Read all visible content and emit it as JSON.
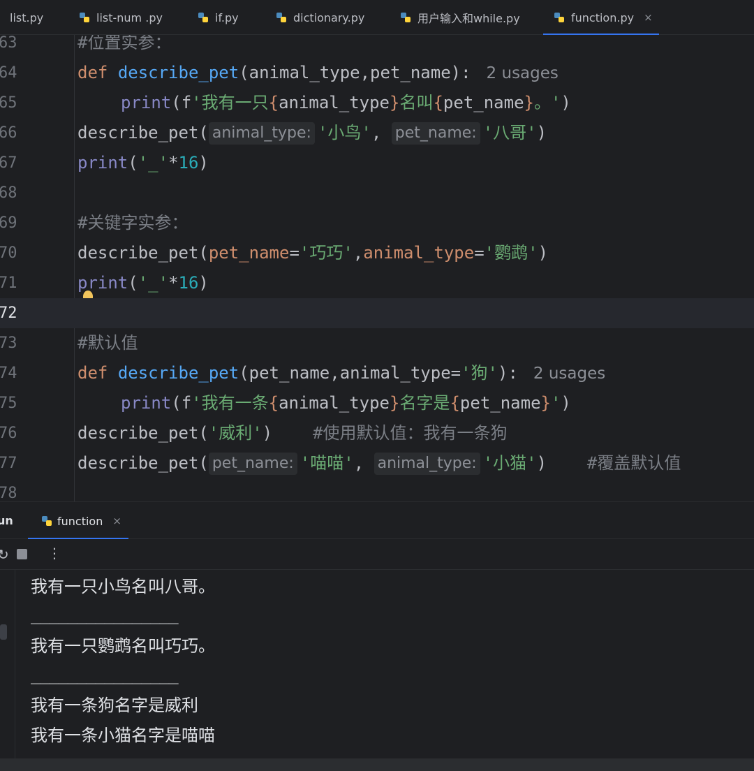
{
  "tabs": [
    {
      "label": "list.py",
      "active": false
    },
    {
      "label": "list-num .py",
      "active": false
    },
    {
      "label": "if.py",
      "active": false
    },
    {
      "label": "dictionary.py",
      "active": false
    },
    {
      "label": "用户输入和while.py",
      "active": false
    },
    {
      "label": "function.py",
      "active": true
    }
  ],
  "tab_close_glyph": "×",
  "editor": {
    "line_numbers": [
      "63",
      "64",
      "65",
      "66",
      "67",
      "68",
      "69",
      "70",
      "71",
      "72",
      "73",
      "74",
      "75",
      "76",
      "77",
      "78"
    ],
    "current_line": "72",
    "l63": {
      "comment": "#位置实参："
    },
    "l64": {
      "kw": "def",
      "fn": "describe_pet",
      "rest": "(animal_type,pet_name):",
      "usages": "2 usages"
    },
    "l65": {
      "fn": "print",
      "a": "(f",
      "s1": "'我有一只",
      "b1": "{",
      "v1": "animal_type",
      "b2": "}",
      "s2": "名叫",
      "b3": "{",
      "v2": "pet_name",
      "b4": "}",
      "s3": "。'",
      "z": ")"
    },
    "l66": {
      "call": "describe_pet(",
      "hint1": "animal_type:",
      "s1": "'小鸟'",
      "comma": ",",
      "hint2": "pet_name:",
      "s2": "'八哥'",
      "z": ")"
    },
    "l67": {
      "fn": "print",
      "a": "(",
      "s": "'_'",
      "op": "*",
      "n": "16",
      "z": ")"
    },
    "l69": {
      "comment": "#关键字实参："
    },
    "l70": {
      "call": "describe_pet(",
      "p1": "pet_name",
      "eq1": "=",
      "s1": "'巧巧'",
      "comma": ",",
      "p2": "animal_type",
      "eq2": "=",
      "s2": "'鹦鹉'",
      "z": ")"
    },
    "l71": {
      "fn1": "p",
      "fn2": "rint",
      "a": "(",
      "s": "'_'",
      "op": "*",
      "n": "16",
      "z": ")"
    },
    "l73": {
      "comment": "#默认值"
    },
    "l74": {
      "kw": "def",
      "fn": "describe_pet",
      "a": "(pet_name,animal_type=",
      "s": "'狗'",
      "z": "):",
      "usages": "2 usages"
    },
    "l75": {
      "fn": "print",
      "a": "(f",
      "s1": "'我有一条",
      "b1": "{",
      "v1": "animal_type",
      "b2": "}",
      "s2": "名字是",
      "b3": "{",
      "v2": "pet_name",
      "b4": "}",
      "s3": "'",
      "z": ")"
    },
    "l76": {
      "call": "describe_pet(",
      "s": "'威利'",
      "z": ")",
      "comment": "#使用默认值：我有一条狗"
    },
    "l77": {
      "call": "describe_pet(",
      "hint1": "pet_name:",
      "s1": "'喵喵'",
      "comma": ",",
      "hint2": "animal_type:",
      "s2": "'小猫'",
      "z": ")",
      "comment": "#覆盖默认值"
    }
  },
  "run_panel": {
    "title": "un",
    "tab_label": "function",
    "more_glyph": "⋮",
    "rerun_glyph": "↻"
  },
  "console_output": [
    "我有一只小鸟名叫八哥。",
    "________________",
    "我有一只鹦鹉名叫巧巧。",
    "________________",
    "我有一条狗名字是威利",
    "我有一条小猫名字是喵喵"
  ],
  "colors": {
    "background": "#1e1f22",
    "keyword": "#cf8e6d",
    "function": "#56a8f5",
    "builtin": "#8888c6",
    "string": "#6aab73",
    "number": "#2aacb8",
    "comment": "#7a7e85",
    "accent": "#3574f0"
  }
}
